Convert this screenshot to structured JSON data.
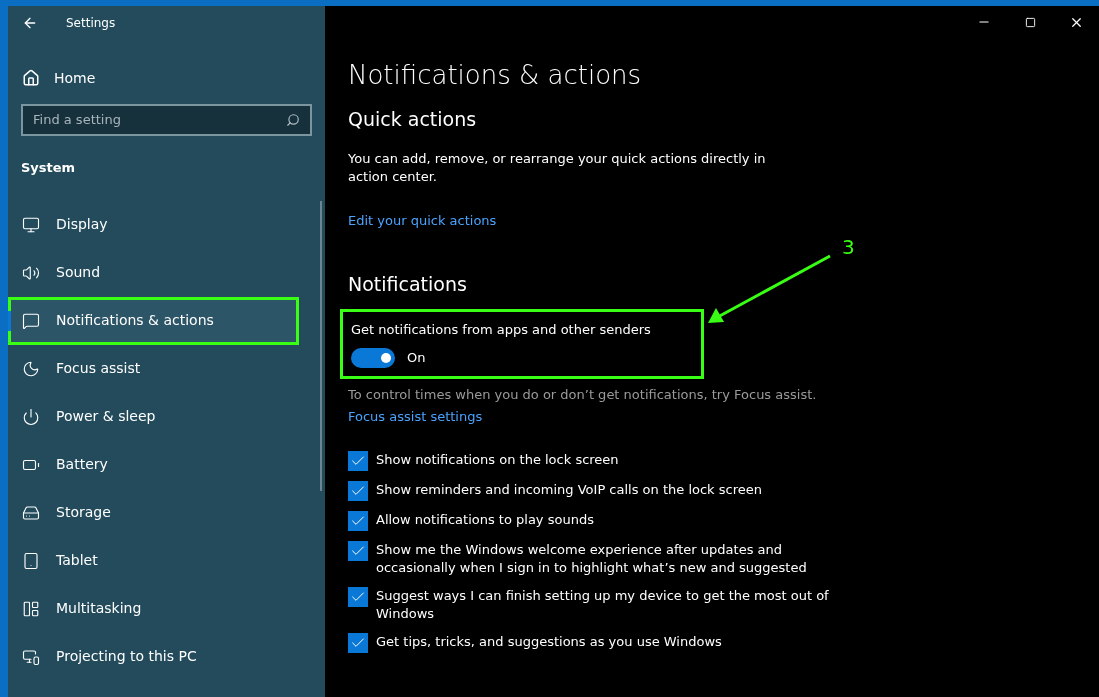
{
  "window": {
    "title": "Settings"
  },
  "sidebar": {
    "home": "Home",
    "search": {
      "placeholder": "Find a setting"
    },
    "section": "System",
    "items": [
      {
        "label": "Display",
        "selected": false,
        "highlighted": false
      },
      {
        "label": "Sound",
        "selected": false,
        "highlighted": false
      },
      {
        "label": "Notifications & actions",
        "selected": true,
        "highlighted": true
      },
      {
        "label": "Focus assist",
        "selected": false,
        "highlighted": false
      },
      {
        "label": "Power & sleep",
        "selected": false,
        "highlighted": false
      },
      {
        "label": "Battery",
        "selected": false,
        "highlighted": false
      },
      {
        "label": "Storage",
        "selected": false,
        "highlighted": false
      },
      {
        "label": "Tablet",
        "selected": false,
        "highlighted": false
      },
      {
        "label": "Multitasking",
        "selected": false,
        "highlighted": false
      },
      {
        "label": "Projecting to this PC",
        "selected": false,
        "highlighted": false
      }
    ]
  },
  "page": {
    "title": "Notifications & actions",
    "quick_actions": {
      "heading": "Quick actions",
      "description": "You can add, remove, or rearrange your quick actions directly in action center.",
      "link": "Edit your quick actions"
    },
    "notifications": {
      "heading": "Notifications",
      "toggle": {
        "label": "Get notifications from apps and other senders",
        "on": true,
        "state_text": "On",
        "highlighted": true
      },
      "hint": "To control times when you do or don’t get notifications, try Focus assist.",
      "link": "Focus assist settings",
      "options": [
        {
          "label": "Show notifications on the lock screen",
          "checked": true
        },
        {
          "label": "Show reminders and incoming VoIP calls on the lock screen",
          "checked": true
        },
        {
          "label": "Allow notifications to play sounds",
          "checked": true
        },
        {
          "label": "Show me the Windows welcome experience after updates and occasionally when I sign in to highlight what’s new and suggested",
          "checked": true
        },
        {
          "label": "Suggest ways I can finish setting up my device to get the most out of Windows",
          "checked": true
        },
        {
          "label": "Get tips, tricks, and suggestions as you use Windows",
          "checked": true
        }
      ]
    }
  },
  "annotation": {
    "label": "3"
  }
}
